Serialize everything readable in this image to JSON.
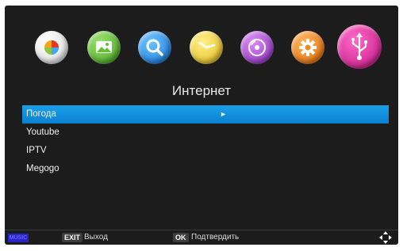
{
  "icons": [
    {
      "name": "photos-icon",
      "color": "#f4f4f4",
      "selected": false
    },
    {
      "name": "gallery-icon",
      "color": "#5fc234",
      "selected": false
    },
    {
      "name": "search-icon",
      "color": "#1c8cf0",
      "selected": false
    },
    {
      "name": "clock-icon",
      "color": "#f2d533",
      "selected": false
    },
    {
      "name": "music-disc-icon",
      "color": "#b04ad6",
      "selected": false
    },
    {
      "name": "settings-gear-icon",
      "color": "#f38212",
      "selected": false
    },
    {
      "name": "usb-icon",
      "color": "#e21f9c",
      "selected": true
    }
  ],
  "page": {
    "title": "Интернет"
  },
  "menu": {
    "items": [
      {
        "label": "Погода",
        "selected": true
      },
      {
        "label": "Youtube",
        "selected": false
      },
      {
        "label": "IPTV",
        "selected": false
      },
      {
        "label": "Megogo",
        "selected": false
      }
    ],
    "selected_arrow": "►"
  },
  "footer": {
    "music_badge": "MUSIC",
    "exit_key": "EXIT",
    "exit_label": "Выход",
    "ok_key": "OK",
    "ok_label": "Подтвердить"
  },
  "colors": {
    "selection": "#0f8ee0",
    "background": "#1c1c1c"
  }
}
